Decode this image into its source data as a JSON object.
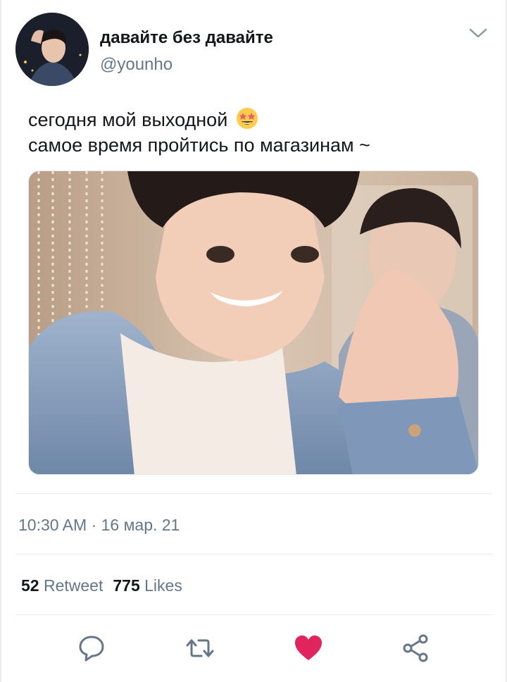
{
  "author": {
    "display_name": "давайте без давайте",
    "handle": "@younho"
  },
  "tweet": {
    "line1": "сегодня мой выходной",
    "line2": "самое время пройтись по магазинам ~",
    "emoji": "star-struck-emoji"
  },
  "meta": {
    "timestamp": "10:30 AM · 16 мар. 21"
  },
  "stats": {
    "retweets_count": "52",
    "retweets_label": "Retweet",
    "likes_count": "775",
    "likes_label": "Likes"
  },
  "actions": [
    {
      "name": "reply",
      "icon": "comment-icon"
    },
    {
      "name": "retweet",
      "icon": "retweet-icon"
    },
    {
      "name": "like",
      "icon": "heart-icon",
      "active": true
    },
    {
      "name": "share",
      "icon": "share-icon"
    }
  ],
  "colors": {
    "text_primary": "#14171a",
    "text_secondary": "#657786",
    "accent": "#1da1f2",
    "like_active": "#e0245e",
    "divider": "#e6ecf0"
  }
}
